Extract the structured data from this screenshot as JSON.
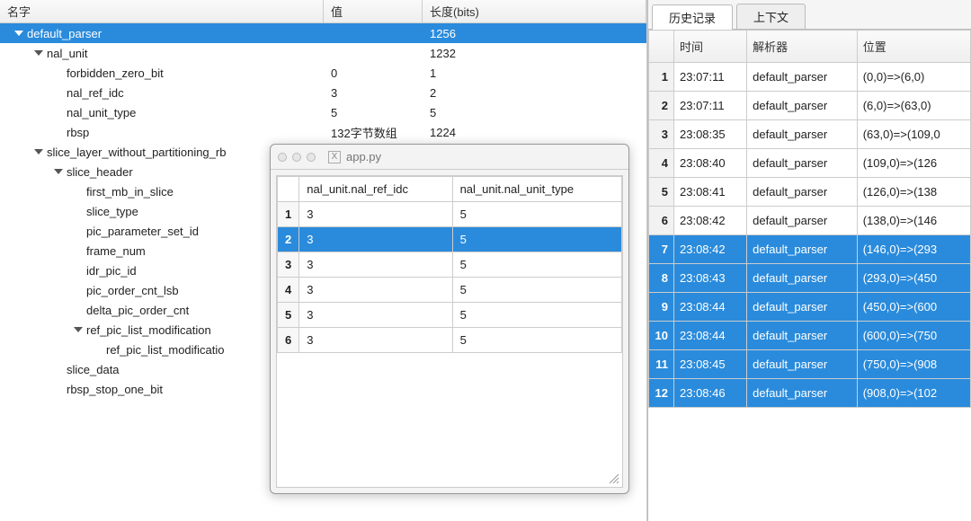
{
  "colors": {
    "accent": "#2a8bdc"
  },
  "tree": {
    "headers": {
      "name": "名字",
      "value": "值",
      "length": "长度(bits)"
    },
    "rows": [
      {
        "indent": 0,
        "twisty": true,
        "name": "default_parser",
        "value": "",
        "length": "1256",
        "selected": true
      },
      {
        "indent": 1,
        "twisty": true,
        "name": "nal_unit",
        "value": "",
        "length": "1232"
      },
      {
        "indent": 2,
        "twisty": false,
        "name": "forbidden_zero_bit",
        "value": "0",
        "length": "1"
      },
      {
        "indent": 2,
        "twisty": false,
        "name": "nal_ref_idc",
        "value": "3",
        "length": "2"
      },
      {
        "indent": 2,
        "twisty": false,
        "name": "nal_unit_type",
        "value": "5",
        "length": "5"
      },
      {
        "indent": 2,
        "twisty": false,
        "name": "rbsp",
        "value": "132字节数组",
        "length": "1224"
      },
      {
        "indent": 1,
        "twisty": true,
        "name": "slice_layer_without_partitioning_rb",
        "value": "",
        "length": ""
      },
      {
        "indent": 2,
        "twisty": true,
        "name": "slice_header",
        "value": "",
        "length": ""
      },
      {
        "indent": 3,
        "twisty": false,
        "name": "first_mb_in_slice",
        "value": "",
        "length": ""
      },
      {
        "indent": 3,
        "twisty": false,
        "name": "slice_type",
        "value": "",
        "length": ""
      },
      {
        "indent": 3,
        "twisty": false,
        "name": "pic_parameter_set_id",
        "value": "",
        "length": ""
      },
      {
        "indent": 3,
        "twisty": false,
        "name": "frame_num",
        "value": "",
        "length": ""
      },
      {
        "indent": 3,
        "twisty": false,
        "name": "idr_pic_id",
        "value": "",
        "length": ""
      },
      {
        "indent": 3,
        "twisty": false,
        "name": "pic_order_cnt_lsb",
        "value": "",
        "length": ""
      },
      {
        "indent": 3,
        "twisty": false,
        "name": "delta_pic_order_cnt",
        "value": "",
        "length": ""
      },
      {
        "indent": 3,
        "twisty": true,
        "name": "ref_pic_list_modification",
        "value": "",
        "length": ""
      },
      {
        "indent": 4,
        "twisty": false,
        "name": "ref_pic_list_modificatio",
        "value": "",
        "length": ""
      },
      {
        "indent": 2,
        "twisty": false,
        "name": "slice_data",
        "value": "",
        "length": ""
      },
      {
        "indent": 2,
        "twisty": false,
        "name": "rbsp_stop_one_bit",
        "value": "",
        "length": ""
      }
    ]
  },
  "right": {
    "tabs": {
      "history": "历史记录",
      "context": "上下文"
    },
    "headers": {
      "time": "时间",
      "parser": "解析器",
      "pos": "位置"
    },
    "rows": [
      {
        "idx": "1",
        "time": "23:07:11",
        "parser": "default_parser",
        "pos": "(0,0)=>(6,0)",
        "sel": false
      },
      {
        "idx": "2",
        "time": "23:07:11",
        "parser": "default_parser",
        "pos": "(6,0)=>(63,0)",
        "sel": false
      },
      {
        "idx": "3",
        "time": "23:08:35",
        "parser": "default_parser",
        "pos": "(63,0)=>(109,0",
        "sel": false
      },
      {
        "idx": "4",
        "time": "23:08:40",
        "parser": "default_parser",
        "pos": "(109,0)=>(126",
        "sel": false
      },
      {
        "idx": "5",
        "time": "23:08:41",
        "parser": "default_parser",
        "pos": "(126,0)=>(138",
        "sel": false
      },
      {
        "idx": "6",
        "time": "23:08:42",
        "parser": "default_parser",
        "pos": "(138,0)=>(146",
        "sel": false
      },
      {
        "idx": "7",
        "time": "23:08:42",
        "parser": "default_parser",
        "pos": "(146,0)=>(293",
        "sel": true
      },
      {
        "idx": "8",
        "time": "23:08:43",
        "parser": "default_parser",
        "pos": "(293,0)=>(450",
        "sel": true
      },
      {
        "idx": "9",
        "time": "23:08:44",
        "parser": "default_parser",
        "pos": "(450,0)=>(600",
        "sel": true
      },
      {
        "idx": "10",
        "time": "23:08:44",
        "parser": "default_parser",
        "pos": "(600,0)=>(750",
        "sel": true
      },
      {
        "idx": "11",
        "time": "23:08:45",
        "parser": "default_parser",
        "pos": "(750,0)=>(908",
        "sel": true
      },
      {
        "idx": "12",
        "time": "23:08:46",
        "parser": "default_parser",
        "pos": "(908,0)=>(102",
        "sel": true
      }
    ]
  },
  "popup": {
    "title": "app.py",
    "x_glyph": "X",
    "headers": {
      "idc": "nal_unit.nal_ref_idc",
      "type": "nal_unit.nal_unit_type"
    },
    "rows": [
      {
        "idx": "1",
        "idc": "3",
        "type": "5",
        "sel": false
      },
      {
        "idx": "2",
        "idc": "3",
        "type": "5",
        "sel": true
      },
      {
        "idx": "3",
        "idc": "3",
        "type": "5",
        "sel": false
      },
      {
        "idx": "4",
        "idc": "3",
        "type": "5",
        "sel": false
      },
      {
        "idx": "5",
        "idc": "3",
        "type": "5",
        "sel": false
      },
      {
        "idx": "6",
        "idc": "3",
        "type": "5",
        "sel": false
      }
    ]
  }
}
